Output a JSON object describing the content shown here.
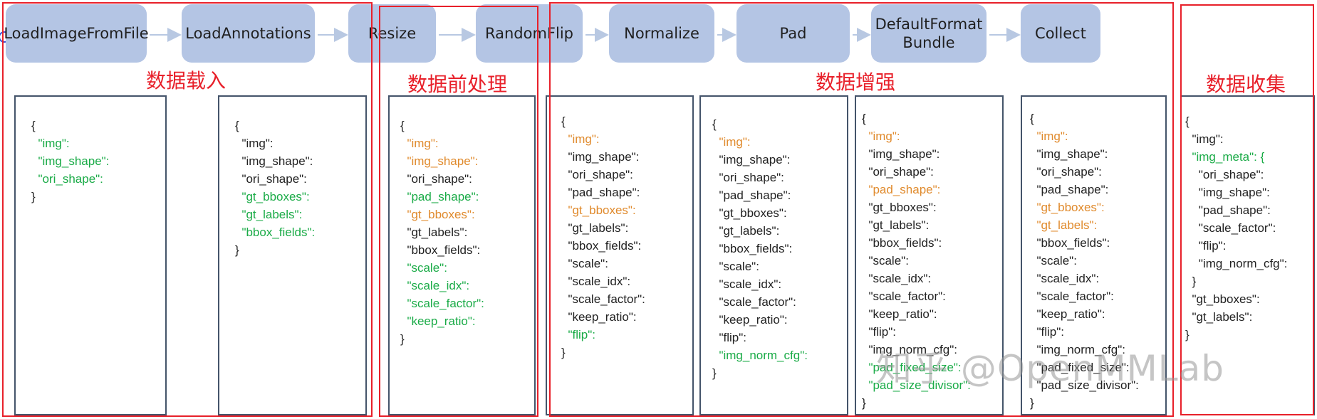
{
  "colors": {
    "stage_fill": "#b4c5e4",
    "group_border": "#e8202a",
    "panel_border": "#44546a",
    "green": "#1aab47",
    "orange": "#e08a2c",
    "arrow": "#b8c8e2"
  },
  "stages": [
    {
      "id": "load-image",
      "label": "LoadImageFromFile"
    },
    {
      "id": "load-annotations",
      "label": "LoadAnnotations"
    },
    {
      "id": "resize",
      "label": "Resize"
    },
    {
      "id": "random-flip",
      "label": "RandomFlip"
    },
    {
      "id": "normalize",
      "label": "Normalize"
    },
    {
      "id": "pad",
      "label": "Pad"
    },
    {
      "id": "default-format-bundle",
      "label": "DefaultFormat\nBundle"
    },
    {
      "id": "collect",
      "label": "Collect"
    }
  ],
  "groups": [
    {
      "id": "data-loading",
      "label": "数据载入"
    },
    {
      "id": "data-preprocessing",
      "label": "数据前处理"
    },
    {
      "id": "data-augmentation",
      "label": "数据增强"
    },
    {
      "id": "data-collection",
      "label": "数据收集"
    }
  ],
  "panels": [
    {
      "id": "load-image",
      "lines": [
        {
          "t": "{",
          "c": "k"
        },
        {
          "t": "  \"img\":",
          "c": "g"
        },
        {
          "t": "  \"img_shape\":",
          "c": "g"
        },
        {
          "t": "  \"ori_shape\":",
          "c": "g"
        },
        {
          "t": "}",
          "c": "k"
        }
      ]
    },
    {
      "id": "load-annotations",
      "lines": [
        {
          "t": "{",
          "c": "k"
        },
        {
          "t": "  \"img\":",
          "c": "k"
        },
        {
          "t": "  \"img_shape\":",
          "c": "k"
        },
        {
          "t": "  \"ori_shape\":",
          "c": "k"
        },
        {
          "t": "  \"gt_bboxes\":",
          "c": "g"
        },
        {
          "t": "  \"gt_labels\":",
          "c": "g"
        },
        {
          "t": "  \"bbox_fields\":",
          "c": "g"
        },
        {
          "t": "}",
          "c": "k"
        }
      ]
    },
    {
      "id": "resize",
      "lines": [
        {
          "t": "{",
          "c": "k"
        },
        {
          "t": "  \"img\":",
          "c": "o"
        },
        {
          "t": "  \"img_shape\":",
          "c": "o"
        },
        {
          "t": "  \"ori_shape\":",
          "c": "k"
        },
        {
          "t": "  \"pad_shape\":",
          "c": "g"
        },
        {
          "t": "  \"gt_bboxes\":",
          "c": "o"
        },
        {
          "t": "  \"gt_labels\":",
          "c": "k"
        },
        {
          "t": "  \"bbox_fields\":",
          "c": "k"
        },
        {
          "t": "  \"scale\":",
          "c": "g"
        },
        {
          "t": "  \"scale_idx\":",
          "c": "g"
        },
        {
          "t": "  \"scale_factor\":",
          "c": "g"
        },
        {
          "t": "  \"keep_ratio\":",
          "c": "g"
        },
        {
          "t": "}",
          "c": "k"
        }
      ]
    },
    {
      "id": "random-flip",
      "lines": [
        {
          "t": "{",
          "c": "k"
        },
        {
          "t": "  \"img\":",
          "c": "o"
        },
        {
          "t": "  \"img_shape\":",
          "c": "k"
        },
        {
          "t": "  \"ori_shape\":",
          "c": "k"
        },
        {
          "t": "  \"pad_shape\":",
          "c": "k"
        },
        {
          "t": "  \"gt_bboxes\":",
          "c": "o"
        },
        {
          "t": "  \"gt_labels\":",
          "c": "k"
        },
        {
          "t": "  \"bbox_fields\":",
          "c": "k"
        },
        {
          "t": "  \"scale\":",
          "c": "k"
        },
        {
          "t": "  \"scale_idx\":",
          "c": "k"
        },
        {
          "t": "  \"scale_factor\":",
          "c": "k"
        },
        {
          "t": "  \"keep_ratio\":",
          "c": "k"
        },
        {
          "t": "  \"flip\":",
          "c": "g"
        },
        {
          "t": "}",
          "c": "k"
        }
      ]
    },
    {
      "id": "normalize",
      "lines": [
        {
          "t": "{",
          "c": "k"
        },
        {
          "t": "  \"img\":",
          "c": "o"
        },
        {
          "t": "  \"img_shape\":",
          "c": "k"
        },
        {
          "t": "  \"ori_shape\":",
          "c": "k"
        },
        {
          "t": "  \"pad_shape\":",
          "c": "k"
        },
        {
          "t": "  \"gt_bboxes\":",
          "c": "k"
        },
        {
          "t": "  \"gt_labels\":",
          "c": "k"
        },
        {
          "t": "  \"bbox_fields\":",
          "c": "k"
        },
        {
          "t": "  \"scale\":",
          "c": "k"
        },
        {
          "t": "  \"scale_idx\":",
          "c": "k"
        },
        {
          "t": "  \"scale_factor\":",
          "c": "k"
        },
        {
          "t": "  \"keep_ratio\":",
          "c": "k"
        },
        {
          "t": "  \"flip\":",
          "c": "k"
        },
        {
          "t": "  \"img_norm_cfg\":",
          "c": "g"
        },
        {
          "t": "}",
          "c": "k"
        }
      ]
    },
    {
      "id": "pad",
      "lines": [
        {
          "t": "{",
          "c": "k"
        },
        {
          "t": "  \"img\":",
          "c": "o"
        },
        {
          "t": "  \"img_shape\":",
          "c": "k"
        },
        {
          "t": "  \"ori_shape\":",
          "c": "k"
        },
        {
          "t": "  \"pad_shape\":",
          "c": "o"
        },
        {
          "t": "  \"gt_bboxes\":",
          "c": "k"
        },
        {
          "t": "  \"gt_labels\":",
          "c": "k"
        },
        {
          "t": "  \"bbox_fields\":",
          "c": "k"
        },
        {
          "t": "  \"scale\":",
          "c": "k"
        },
        {
          "t": "  \"scale_idx\":",
          "c": "k"
        },
        {
          "t": "  \"scale_factor\":",
          "c": "k"
        },
        {
          "t": "  \"keep_ratio\":",
          "c": "k"
        },
        {
          "t": "  \"flip\":",
          "c": "k"
        },
        {
          "t": "  \"img_norm_cfg\":",
          "c": "k"
        },
        {
          "t": "  \"pad_fixed_size\":",
          "c": "g"
        },
        {
          "t": "  \"pad_size_divisor\":",
          "c": "g"
        },
        {
          "t": "}",
          "c": "k"
        }
      ]
    },
    {
      "id": "default-format-bundle",
      "lines": [
        {
          "t": "{",
          "c": "k"
        },
        {
          "t": "  \"img\":",
          "c": "o"
        },
        {
          "t": "  \"img_shape\":",
          "c": "k"
        },
        {
          "t": "  \"ori_shape\":",
          "c": "k"
        },
        {
          "t": "  \"pad_shape\":",
          "c": "k"
        },
        {
          "t": "  \"gt_bboxes\":",
          "c": "o"
        },
        {
          "t": "  \"gt_labels\":",
          "c": "o"
        },
        {
          "t": "  \"bbox_fields\":",
          "c": "k"
        },
        {
          "t": "  \"scale\":",
          "c": "k"
        },
        {
          "t": "  \"scale_idx\":",
          "c": "k"
        },
        {
          "t": "  \"scale_factor\":",
          "c": "k"
        },
        {
          "t": "  \"keep_ratio\":",
          "c": "k"
        },
        {
          "t": "  \"flip\":",
          "c": "k"
        },
        {
          "t": "  \"img_norm_cfg\":",
          "c": "k"
        },
        {
          "t": "  \"pad_fixed_size\":",
          "c": "k"
        },
        {
          "t": "  \"pad_size_divisor\":",
          "c": "k"
        },
        {
          "t": "}",
          "c": "k"
        }
      ]
    },
    {
      "id": "collect",
      "lines": [
        {
          "t": "{",
          "c": "k"
        },
        {
          "t": "  \"img\":",
          "c": "k"
        },
        {
          "t": "  \"img_meta\": {",
          "c": "g"
        },
        {
          "t": "    \"ori_shape\":",
          "c": "k"
        },
        {
          "t": "    \"img_shape\":",
          "c": "k"
        },
        {
          "t": "    \"pad_shape\":",
          "c": "k"
        },
        {
          "t": "    \"scale_factor\":",
          "c": "k"
        },
        {
          "t": "    \"flip\":",
          "c": "k"
        },
        {
          "t": "    \"img_norm_cfg\":",
          "c": "k"
        },
        {
          "t": "  }",
          "c": "k"
        },
        {
          "t": "  \"gt_bboxes\":",
          "c": "k"
        },
        {
          "t": "  \"gt_labels\":",
          "c": "k"
        },
        {
          "t": "}",
          "c": "k"
        }
      ]
    }
  ],
  "watermark": "知乎 @OpenMMLab"
}
